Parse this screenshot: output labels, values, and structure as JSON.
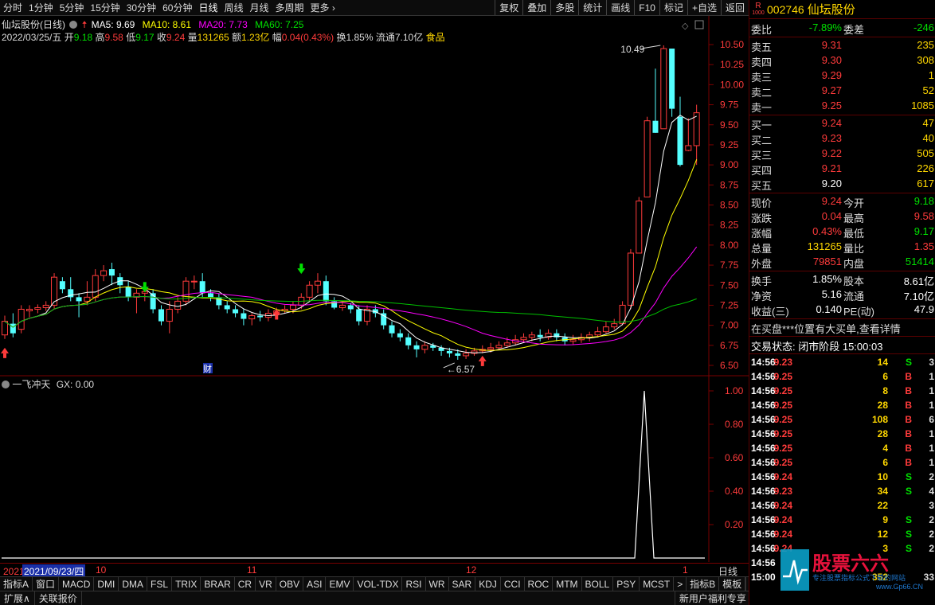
{
  "toolbar": {
    "periods": [
      "分时",
      "1分钟",
      "5分钟",
      "15分钟",
      "30分钟",
      "60分钟",
      "日线",
      "周线",
      "月线",
      "多周期",
      "更多"
    ],
    "active_period": "日线",
    "tools": [
      "复权",
      "叠加",
      "多股",
      "统计",
      "画线",
      "F10",
      "标记",
      "+自选",
      "返回"
    ]
  },
  "info": {
    "stock_label": "仙坛股份(日线)",
    "ma5": "MA5: 9.69",
    "ma10": "MA10: 8.61",
    "ma20": "MA20: 7.73",
    "ma60": "MA60: 7.25",
    "date": "2022/03/25/五",
    "open_label": "开",
    "open": "9.18",
    "high_label": "高",
    "high": "9.58",
    "low_label": "低",
    "low": "9.17",
    "close_label": "收",
    "close": "9.24",
    "vol_label": "量",
    "vol": "131265",
    "amt_label": "额",
    "amt": "1.23亿",
    "chg_label": "幅",
    "chg": "0.04(0.43%)",
    "turnover": "换1.85%",
    "float": "流通7.10亿",
    "sector": "食品",
    "high_mark": "10.49",
    "low_mark": "6.57",
    "fin_mark": "财",
    "colors": {
      "ma5": "#ffffff",
      "ma10": "#ffff00",
      "ma20": "#ff00ff",
      "ma60": "#00c000",
      "up": "#ff3b3b",
      "down": "#54ffff"
    }
  },
  "indicator": {
    "name": "一飞冲天",
    "gx": "GX: 0.00",
    "axis": [
      "1.00",
      "0.80",
      "0.60",
      "0.40",
      "0.20"
    ]
  },
  "price_axis": [
    "10.50",
    "10.25",
    "10.00",
    "9.75",
    "9.50",
    "9.25",
    "9.00",
    "8.75",
    "8.50",
    "8.25",
    "8.00",
    "7.75",
    "7.50",
    "7.25",
    "7.00",
    "6.75",
    "6.50"
  ],
  "date_axis": {
    "year_tag": "2021年",
    "cursor": "2021/09/23/四",
    "labels": [
      "10",
      "11",
      "12",
      "1"
    ],
    "period_label": "日线"
  },
  "stock": {
    "badge_top": "R",
    "badge_bottom": "1000",
    "code": "002746",
    "name": "仙坛股份"
  },
  "weibi": {
    "label": "委比",
    "value": "-7.89%",
    "label2": "委差",
    "value2": "-246"
  },
  "sells": [
    {
      "label": "卖五",
      "price": "9.31",
      "vol": "235"
    },
    {
      "label": "卖四",
      "price": "9.30",
      "vol": "308"
    },
    {
      "label": "卖三",
      "price": "9.29",
      "vol": "1"
    },
    {
      "label": "卖二",
      "price": "9.27",
      "vol": "52"
    },
    {
      "label": "卖一",
      "price": "9.25",
      "vol": "1085"
    }
  ],
  "buys": [
    {
      "label": "买一",
      "price": "9.24",
      "vol": "47"
    },
    {
      "label": "买二",
      "price": "9.23",
      "vol": "40"
    },
    {
      "label": "买三",
      "price": "9.22",
      "vol": "505"
    },
    {
      "label": "买四",
      "price": "9.21",
      "vol": "226"
    },
    {
      "label": "买五",
      "price": "9.20",
      "vol": "617"
    }
  ],
  "quote": [
    {
      "l1": "现价",
      "v1": "9.24",
      "c1": "red",
      "l2": "今开",
      "v2": "9.18",
      "c2": "green"
    },
    {
      "l1": "涨跌",
      "v1": "0.04",
      "c1": "red",
      "l2": "最高",
      "v2": "9.58",
      "c2": "red"
    },
    {
      "l1": "涨幅",
      "v1": "0.43%",
      "c1": "red",
      "l2": "最低",
      "v2": "9.17",
      "c2": "green"
    },
    {
      "l1": "总量",
      "v1": "131265",
      "c1": "yellow",
      "l2": "量比",
      "v2": "1.35",
      "c2": "red"
    },
    {
      "l1": "外盘",
      "v1": "79851",
      "c1": "red",
      "l2": "内盘",
      "v2": "51414",
      "c2": "green"
    }
  ],
  "fund": [
    {
      "l1": "换手",
      "v1": "1.85%",
      "l2": "股本",
      "v2": "8.61亿"
    },
    {
      "l1": "净资",
      "v1": "5.16",
      "l2": "流通",
      "v2": "7.10亿"
    },
    {
      "l1": "收益(三)",
      "v1": "0.140",
      "l2": "PE(动)",
      "v2": "47.9"
    }
  ],
  "notice": "在买盘***位置有大买单,查看详情",
  "trade_state": "交易状态: 闭市阶段 15:00:03",
  "ticks": [
    {
      "t": "14:56",
      "p": "9.23",
      "v": "14",
      "s": "S",
      "n": "3"
    },
    {
      "t": "14:56",
      "p": "9.25",
      "v": "6",
      "s": "B",
      "n": "1"
    },
    {
      "t": "14:56",
      "p": "9.25",
      "v": "8",
      "s": "B",
      "n": "1"
    },
    {
      "t": "14:56",
      "p": "9.25",
      "v": "28",
      "s": "B",
      "n": "1"
    },
    {
      "t": "14:56",
      "p": "9.25",
      "v": "108",
      "s": "B",
      "n": "6"
    },
    {
      "t": "14:56",
      "p": "9.25",
      "v": "28",
      "s": "B",
      "n": "1"
    },
    {
      "t": "14:56",
      "p": "9.25",
      "v": "4",
      "s": "B",
      "n": "1"
    },
    {
      "t": "14:56",
      "p": "9.25",
      "v": "6",
      "s": "B",
      "n": "1"
    },
    {
      "t": "14:56",
      "p": "9.24",
      "v": "10",
      "s": "S",
      "n": "2"
    },
    {
      "t": "14:56",
      "p": "9.23",
      "v": "34",
      "s": "S",
      "n": "4"
    },
    {
      "t": "14:56",
      "p": "9.24",
      "v": "22",
      "s": "",
      "n": "3"
    },
    {
      "t": "14:56",
      "p": "9.24",
      "v": "9",
      "s": "S",
      "n": "2"
    },
    {
      "t": "14:56",
      "p": "9.24",
      "v": "12",
      "s": "S",
      "n": "2"
    },
    {
      "t": "14:56",
      "p": "9.24",
      "v": "3",
      "s": "S",
      "n": "2"
    },
    {
      "t": "14:56",
      "p": "",
      "v": "",
      "s": "",
      "n": ""
    },
    {
      "t": "15:00",
      "p": "",
      "v": "352",
      "s": "",
      "n": "33"
    }
  ],
  "bottom_tabs": [
    "指标A",
    "窗口",
    "MACD",
    "DMI",
    "DMA",
    "FSL",
    "TRIX",
    "BRAR",
    "CR",
    "VR",
    "OBV",
    "ASI",
    "EMV",
    "VOL-TDX",
    "RSI",
    "WR",
    "SAR",
    "KDJ",
    "CCI",
    "ROC",
    "MTM",
    "BOLL",
    "PSY",
    "MCST",
    ">",
    "指标B",
    "模板"
  ],
  "zoom": [
    "+",
    "−"
  ],
  "status_bar": {
    "left": [
      "扩展∧",
      "关联报价"
    ],
    "ad": "新用户福利专享",
    "right": [
      "笔",
      "价",
      "细",
      "势",
      "联",
      "值",
      "主"
    ]
  },
  "watermark": {
    "title": "股票六六",
    "sub": "专注股票指标公式下载的网站",
    "url": "www.Gp66.CN"
  }
}
